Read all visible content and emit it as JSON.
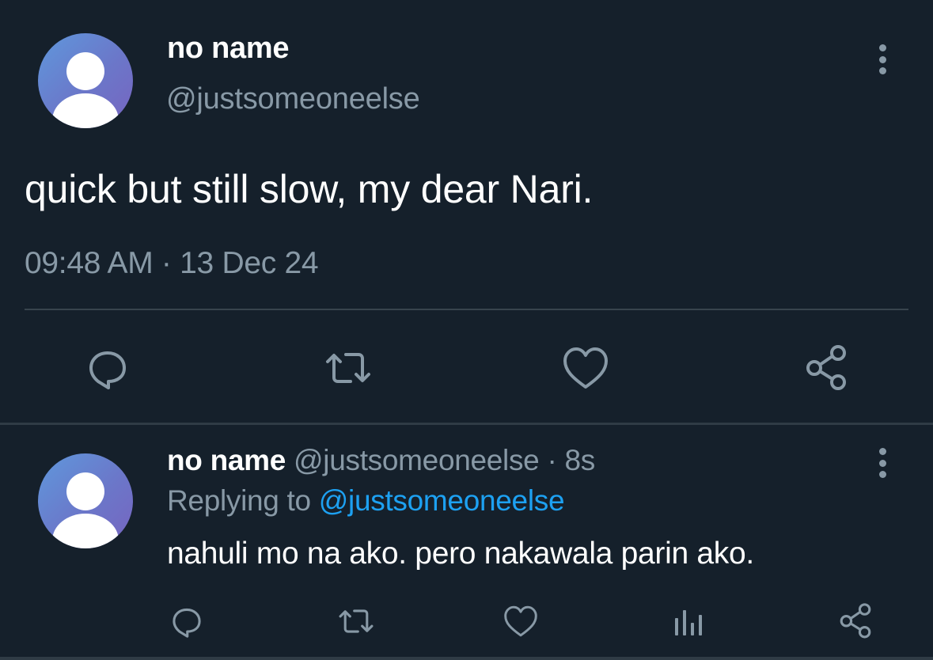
{
  "tweet": {
    "author": {
      "display_name": "no name",
      "handle": "@justsomeoneelse",
      "avatar_icon": "default-person-icon"
    },
    "text": "quick but still slow, my dear Nari.",
    "timestamp": "09:48 AM · 13 Dec 24",
    "actions": [
      "reply-icon",
      "retweet-icon",
      "like-icon",
      "share-icon"
    ]
  },
  "reply": {
    "author": {
      "display_name": "no name",
      "handle": "@justsomeoneelse",
      "avatar_icon": "default-person-icon"
    },
    "separator": " · ",
    "age": "8s",
    "replying_prefix": "Replying to ",
    "replying_to": "@justsomeoneelse",
    "text": "nahuli mo na ako. pero nakawala parin ako.",
    "actions": [
      "reply-icon",
      "retweet-icon",
      "like-icon",
      "analytics-icon",
      "share-icon"
    ]
  },
  "colors": {
    "background": "#15202b",
    "secondary_text": "#8899a6",
    "link": "#1da1f2",
    "divider": "#38444d"
  }
}
